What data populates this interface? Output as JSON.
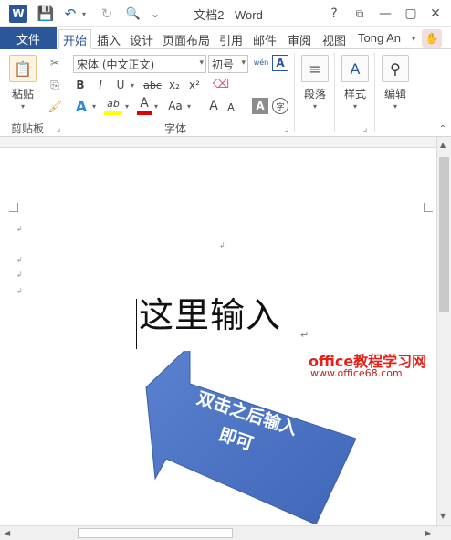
{
  "app": {
    "window_title": "文档2 - Word",
    "logo": "W",
    "help": "?",
    "minimize": "—",
    "maximize": "▢",
    "close": "✕",
    "restore_ribbon": "⧉"
  },
  "qat": {
    "save_icon": "💾",
    "undo_icon": "↶",
    "redo_icon": "↻",
    "print_preview_icon": "🔍",
    "customize_icon": "⌄"
  },
  "tabs": {
    "file": "文件",
    "home": "开始",
    "insert": "插入",
    "design": "设计",
    "layout": "页面布局",
    "references": "引用",
    "mailings": "邮件",
    "review": "审阅",
    "view": "视图"
  },
  "user": {
    "name": "Tong An"
  },
  "ribbon": {
    "clipboard": {
      "paste": "粘贴",
      "group": "剪贴板"
    },
    "font": {
      "name": "宋体 (中文正文)",
      "size": "初号",
      "group": "字体",
      "wen": "wén",
      "bold": "B",
      "italic": "I",
      "underline": "U",
      "strike": "abc",
      "sub": "x₂",
      "sup": "x²",
      "text_effect": "A",
      "highlight": "ab",
      "font_color": "A",
      "case": "Aa",
      "grow": "A",
      "shrink": "A",
      "shade": "A",
      "enclose": "字",
      "border_a": "A"
    },
    "paragraph": {
      "label": "段落"
    },
    "styles": {
      "label": "样式"
    },
    "editing": {
      "label": "编辑"
    }
  },
  "document": {
    "text": "这里输入",
    "callout": {
      "line1": "双击之后输入",
      "line2": "即可",
      "color": "#4a72c4"
    }
  },
  "watermark": {
    "line1": "office教程学习网",
    "line2": "www.office68.com"
  },
  "colors": {
    "accent": "#2b579a",
    "highlight": "#ffff00",
    "font_red": "#e00000"
  }
}
